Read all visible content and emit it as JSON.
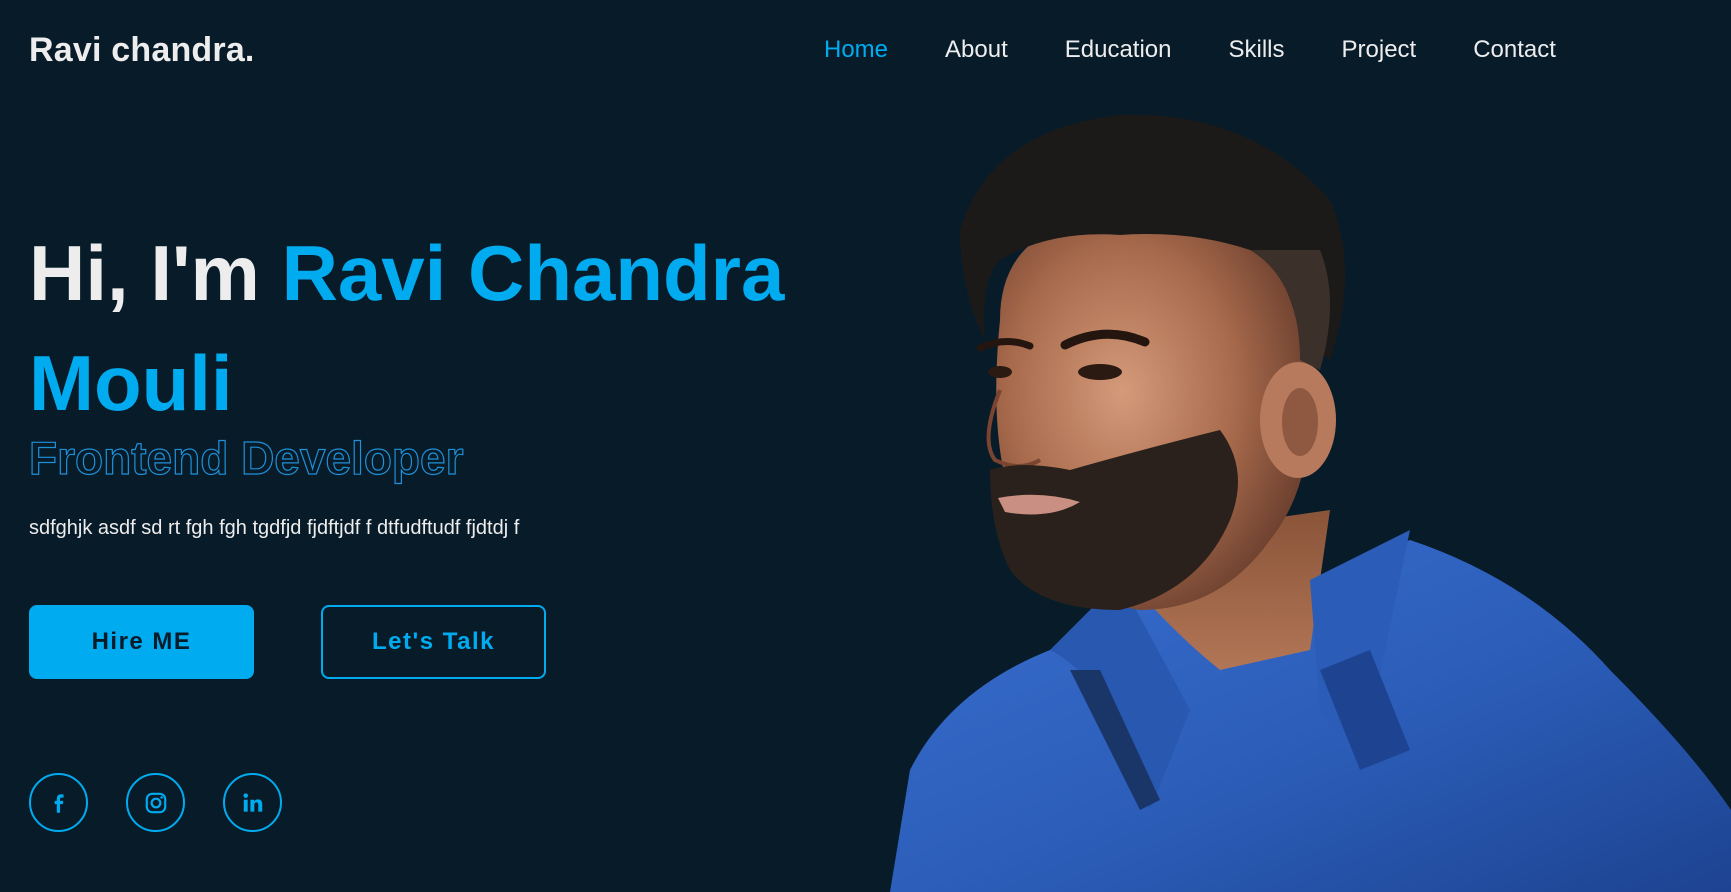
{
  "header": {
    "logo": "Ravi chandra.",
    "nav": [
      {
        "label": "Home",
        "active": true
      },
      {
        "label": "About",
        "active": false
      },
      {
        "label": "Education",
        "active": false
      },
      {
        "label": "Skills",
        "active": false
      },
      {
        "label": "Project",
        "active": false
      },
      {
        "label": "Contact",
        "active": false
      }
    ]
  },
  "hero": {
    "greeting": "Hi, I'm ",
    "name": "Ravi Chandra Mouli",
    "role": "Frontend Developer",
    "description": "sdfghjk asdf sd rt fgh fgh tgdfjd fjdftjdf f dtfudftudf fjdtdj f",
    "buttons": {
      "hire": "Hire ME",
      "talk": "Let's Talk"
    },
    "social_icons": [
      "facebook-icon",
      "instagram-icon",
      "linkedin-icon"
    ]
  },
  "colors": {
    "background": "#081b29",
    "accent": "#00abf0",
    "text": "#ededed",
    "shirt": "#2b5db8",
    "skin": "#b77a5c",
    "hair": "#1c1a19"
  }
}
